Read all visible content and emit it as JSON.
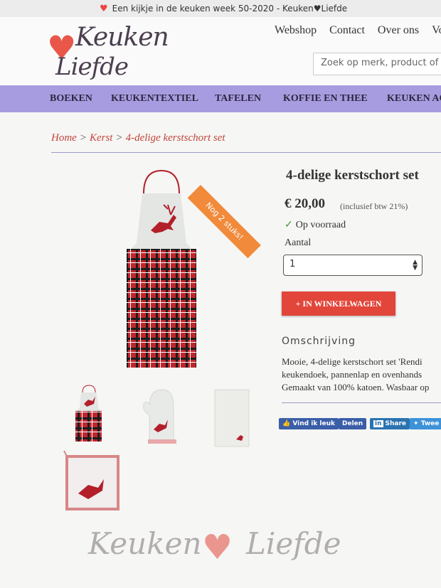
{
  "announcement": {
    "text": "Een kijkje in de keuken week 50-2020 - Keuken♥Liefde"
  },
  "logo": {
    "line1": "Keuken",
    "line2": "Liefde"
  },
  "top_nav": [
    "Webshop",
    "Contact",
    "Over ons",
    "Vo"
  ],
  "search": {
    "placeholder": "Zoek op merk, product of tref"
  },
  "menu": [
    "BOEKEN",
    "KEUKENTEXTIEL",
    "TAFELEN",
    "KOFFIE EN THEE",
    "KEUKEN AC"
  ],
  "breadcrumb": {
    "home": "Home",
    "category": "Kerst",
    "current": "4-delige kerstschort set",
    "sep": ">"
  },
  "ribbon": "Nog 2 stuks!",
  "product": {
    "title": "4-delige kerstschort set",
    "price": "€ 20,00",
    "vat": "(inclusief btw 21%)",
    "stock": "Op voorraad",
    "quantity_label": "Aantal",
    "quantity_value": "1",
    "cart_button": "+ IN WINKELWAGEN"
  },
  "description": {
    "heading": "Omschrijving",
    "lines": [
      "Mooie, 4-delige kerstschort set 'Rendi",
      "keukendoek, pannenlap en ovenhands",
      "Gemaakt van 100% katoen. Wasbaar op"
    ]
  },
  "social": {
    "like": "Vind ik leuk",
    "share": "Delen",
    "linkedin": "Share",
    "tweet": "Twee"
  },
  "watermark": {
    "left": "Keuken",
    "right": "Liefde"
  },
  "colors": {
    "menu_bg": "#a89ce0",
    "accent_red": "#e2453a",
    "ribbon": "#f18a3a",
    "link": "#c0443a"
  }
}
